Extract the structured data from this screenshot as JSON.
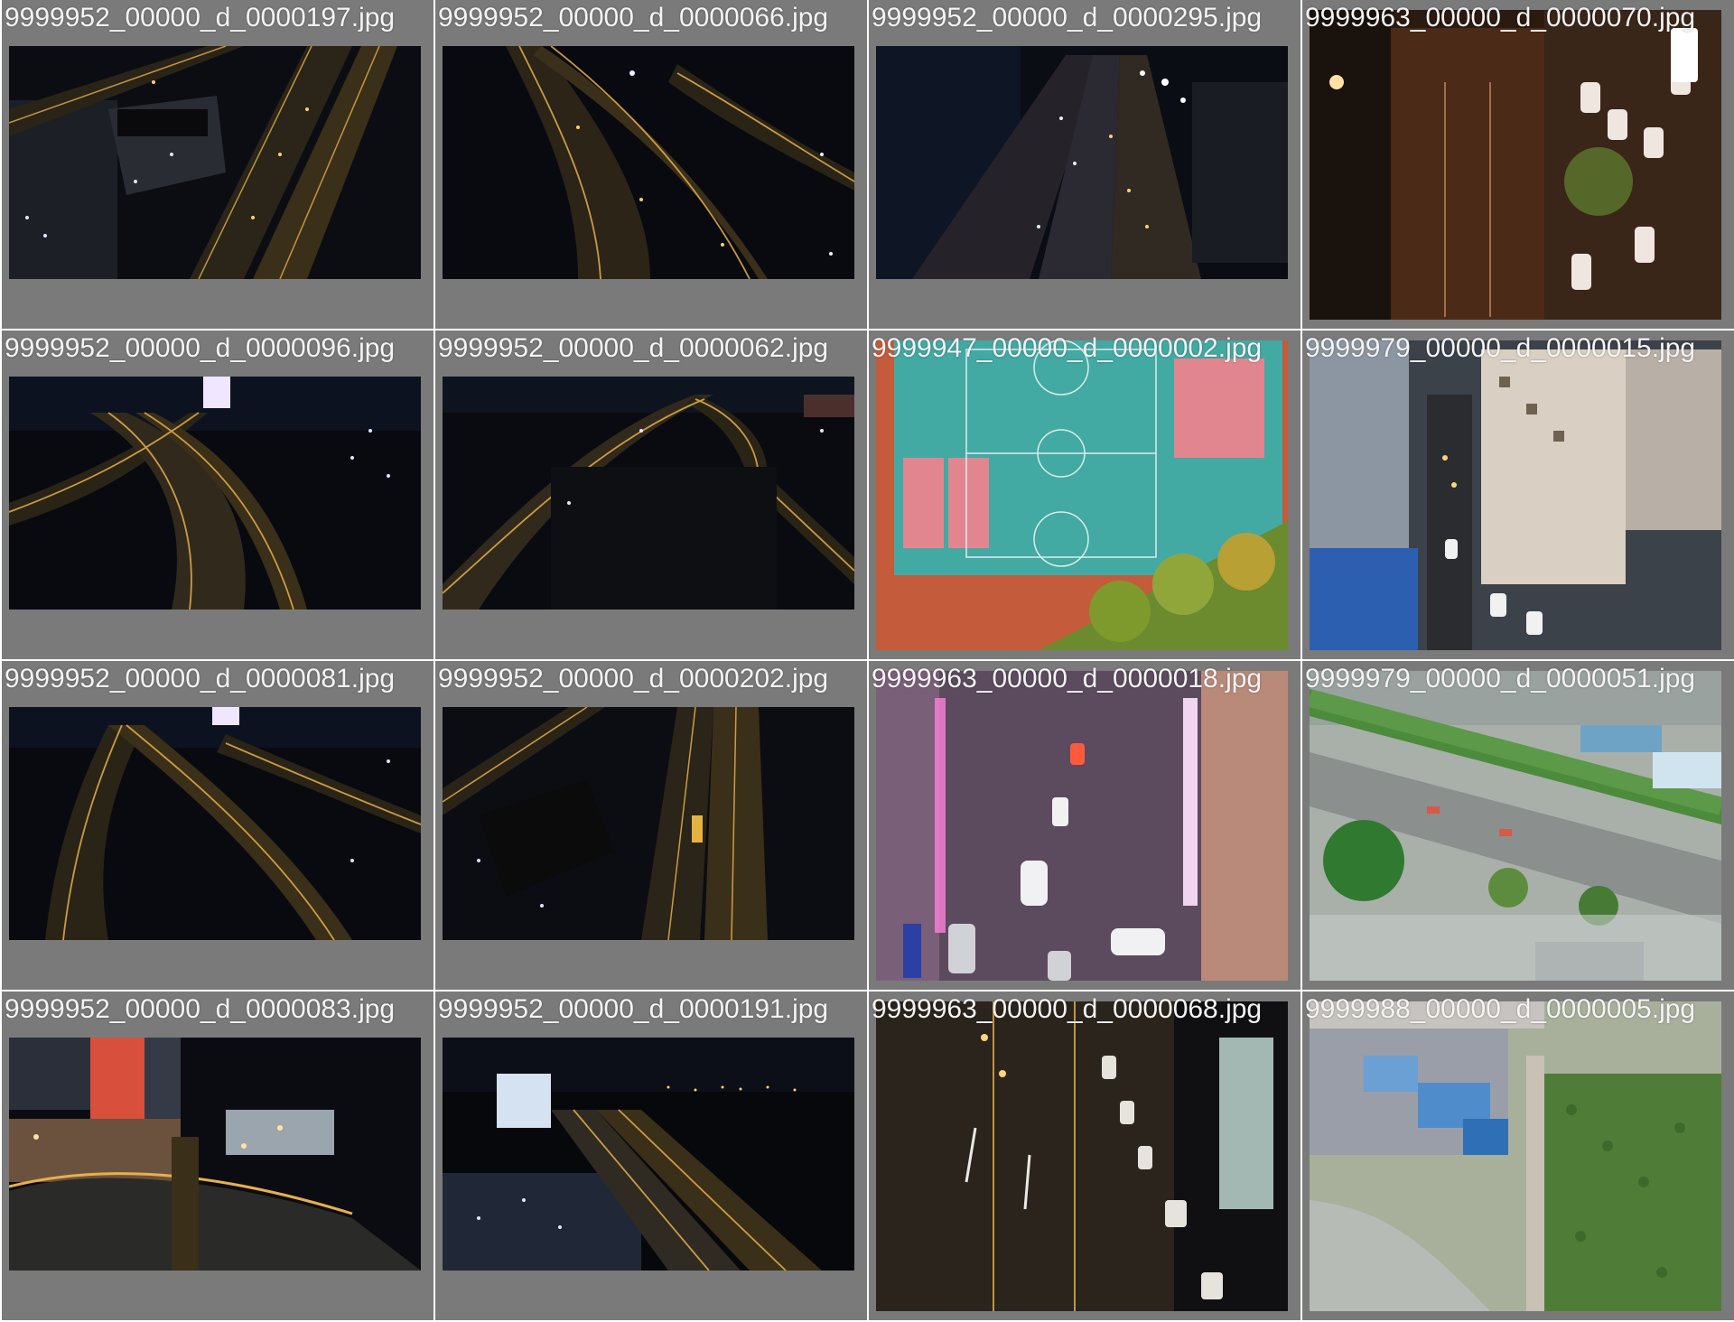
{
  "grid": {
    "columns": 4,
    "rows": 4,
    "background_color": "#7a7a7a",
    "label_color": "#f4f4f4"
  },
  "tiles": [
    {
      "filename": "9999952_00000_d_0000197.jpg",
      "scene": "night-highway-overpass",
      "fit": "letterbox"
    },
    {
      "filename": "9999952_00000_d_0000066.jpg",
      "scene": "night-highway-curve",
      "fit": "letterbox"
    },
    {
      "filename": "9999952_00000_d_0000295.jpg",
      "scene": "night-highway-straight",
      "fit": "letterbox"
    },
    {
      "filename": "9999963_00000_d_0000070.jpg",
      "scene": "night-street-parking",
      "fit": "full"
    },
    {
      "filename": "9999952_00000_d_0000096.jpg",
      "scene": "night-highway-interchange",
      "fit": "letterbox"
    },
    {
      "filename": "9999952_00000_d_0000062.jpg",
      "scene": "night-highway-ramps",
      "fit": "letterbox"
    },
    {
      "filename": "9999947_00000_d_0000002.jpg",
      "scene": "sports-courts",
      "fit": "full"
    },
    {
      "filename": "9999979_00000_d_0000015.jpg",
      "scene": "apartment-buildings",
      "fit": "full"
    },
    {
      "filename": "9999952_00000_d_0000081.jpg",
      "scene": "night-highway-curve",
      "fit": "letterbox"
    },
    {
      "filename": "9999952_00000_d_0000202.jpg",
      "scene": "night-highway-overpass",
      "fit": "letterbox"
    },
    {
      "filename": "9999963_00000_d_0000018.jpg",
      "scene": "night-street-neon",
      "fit": "full"
    },
    {
      "filename": "9999979_00000_d_0000051.jpg",
      "scene": "day-road-trees",
      "fit": "full"
    },
    {
      "filename": "9999952_00000_d_0000083.jpg",
      "scene": "night-city-billboard",
      "fit": "letterbox"
    },
    {
      "filename": "9999952_00000_d_0000191.jpg",
      "scene": "night-bridge-harbor",
      "fit": "letterbox"
    },
    {
      "filename": "9999963_00000_d_0000068.jpg",
      "scene": "night-street-traffic",
      "fit": "full"
    },
    {
      "filename": "9999988_00000_d_0000005.jpg",
      "scene": "day-village-field",
      "fit": "full"
    }
  ]
}
